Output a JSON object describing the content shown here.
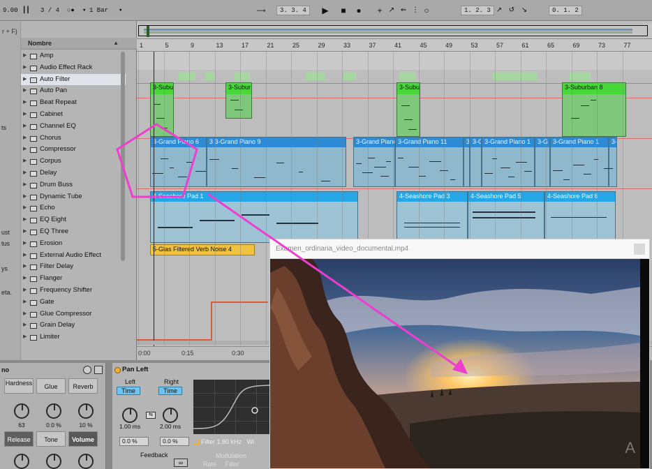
{
  "transport": {
    "tempo": "9.00",
    "meter": "3 / 4",
    "quantize": "1 Bar",
    "position": "3. 3. 4",
    "loop_start": "1. 2. 3",
    "loop_length": "0. 1. 2"
  },
  "browser": {
    "filter_hint": "r + F)",
    "column_header": "Nombre",
    "side_labels": [
      "ts",
      "ust",
      "tus",
      "ys",
      "eta."
    ],
    "items": [
      "Amp",
      "Audio Effect Rack",
      "Auto Filter",
      "Auto Pan",
      "Beat Repeat",
      "Cabinet",
      "Channel EQ",
      "Chorus",
      "Compressor",
      "Corpus",
      "Delay",
      "Drum Buss",
      "Dynamic Tube",
      "Echo",
      "EQ Eight",
      "EQ Three",
      "Erosion",
      "External Audio Effect",
      "Filter Delay",
      "Flanger",
      "Frequency Shifter",
      "Gate",
      "Glue Compressor",
      "Grain Delay",
      "Limiter"
    ],
    "selected_item": "Auto Filter"
  },
  "arrangement": {
    "bar_numbers": [
      "1",
      "5",
      "9",
      "13",
      "17",
      "21",
      "25",
      "29",
      "33",
      "37",
      "41",
      "45",
      "49",
      "53",
      "57",
      "61",
      "65",
      "69",
      "73",
      "77"
    ],
    "time_labels": [
      "0:00",
      "0:15",
      "0:30"
    ],
    "clips": {
      "suburban_1": "3-Subu",
      "suburban_2": "3-Subur",
      "suburban_3": "3-Subu",
      "suburban_4": "3-Suburban 8",
      "piano_1": "3-Grand Piano 6",
      "piano_2": "3 3-Grand Piano 9",
      "piano_3": "3-Grand Piano",
      "piano_4": "3-Grand Piano 11",
      "piano_5": "3",
      "piano_6": "3-G",
      "piano_7": "3-Grand Piano 1",
      "piano_8": "3-G",
      "piano_9": "3-Grand Piano 1",
      "piano_10": "3-",
      "seashore_1": "4-Seashore Pad 1",
      "seashore_2": "4-Seashore Pad 3",
      "seashore_3": "4-Seashore Pad 5",
      "seashore_4": "4-Seashore Pad 6",
      "glas": "5-Glas Filtered Verb Noise 4"
    }
  },
  "drum_buss": {
    "title": "no",
    "buttons": [
      "Hardness",
      "Glue",
      "Reverb"
    ],
    "knob_values": [
      "63",
      "0.0 %",
      "10 %"
    ],
    "buttons_row2": [
      "Release",
      "Tone",
      "Volume"
    ]
  },
  "pan_left": {
    "title": "Pan Left",
    "left_label": "Left",
    "right_label": "Right",
    "left_mode": "Time",
    "right_mode": "Time",
    "left_value": "1.00 ms",
    "right_value": "2.00 ms",
    "left_field": "0.0 %",
    "right_field": "0.0 %",
    "filter_text": "Filter  1.80 kHz",
    "filter_suffix": "Wi",
    "feedback": "Feedback",
    "modulation": "Modulation",
    "rate": "Rate",
    "filter_lbl": "Filter",
    "loop_symbol": "∞"
  },
  "video": {
    "title": "Examen_ordinaria_video_documental.mp4",
    "logo": "A"
  },
  "colors": {
    "annotation": "#ec3fd0",
    "clip_green": "#48d83a",
    "clip_blue": "#2c8ad6",
    "clip_cyan": "#26a6e6",
    "clip_orange": "#f1c23e"
  }
}
